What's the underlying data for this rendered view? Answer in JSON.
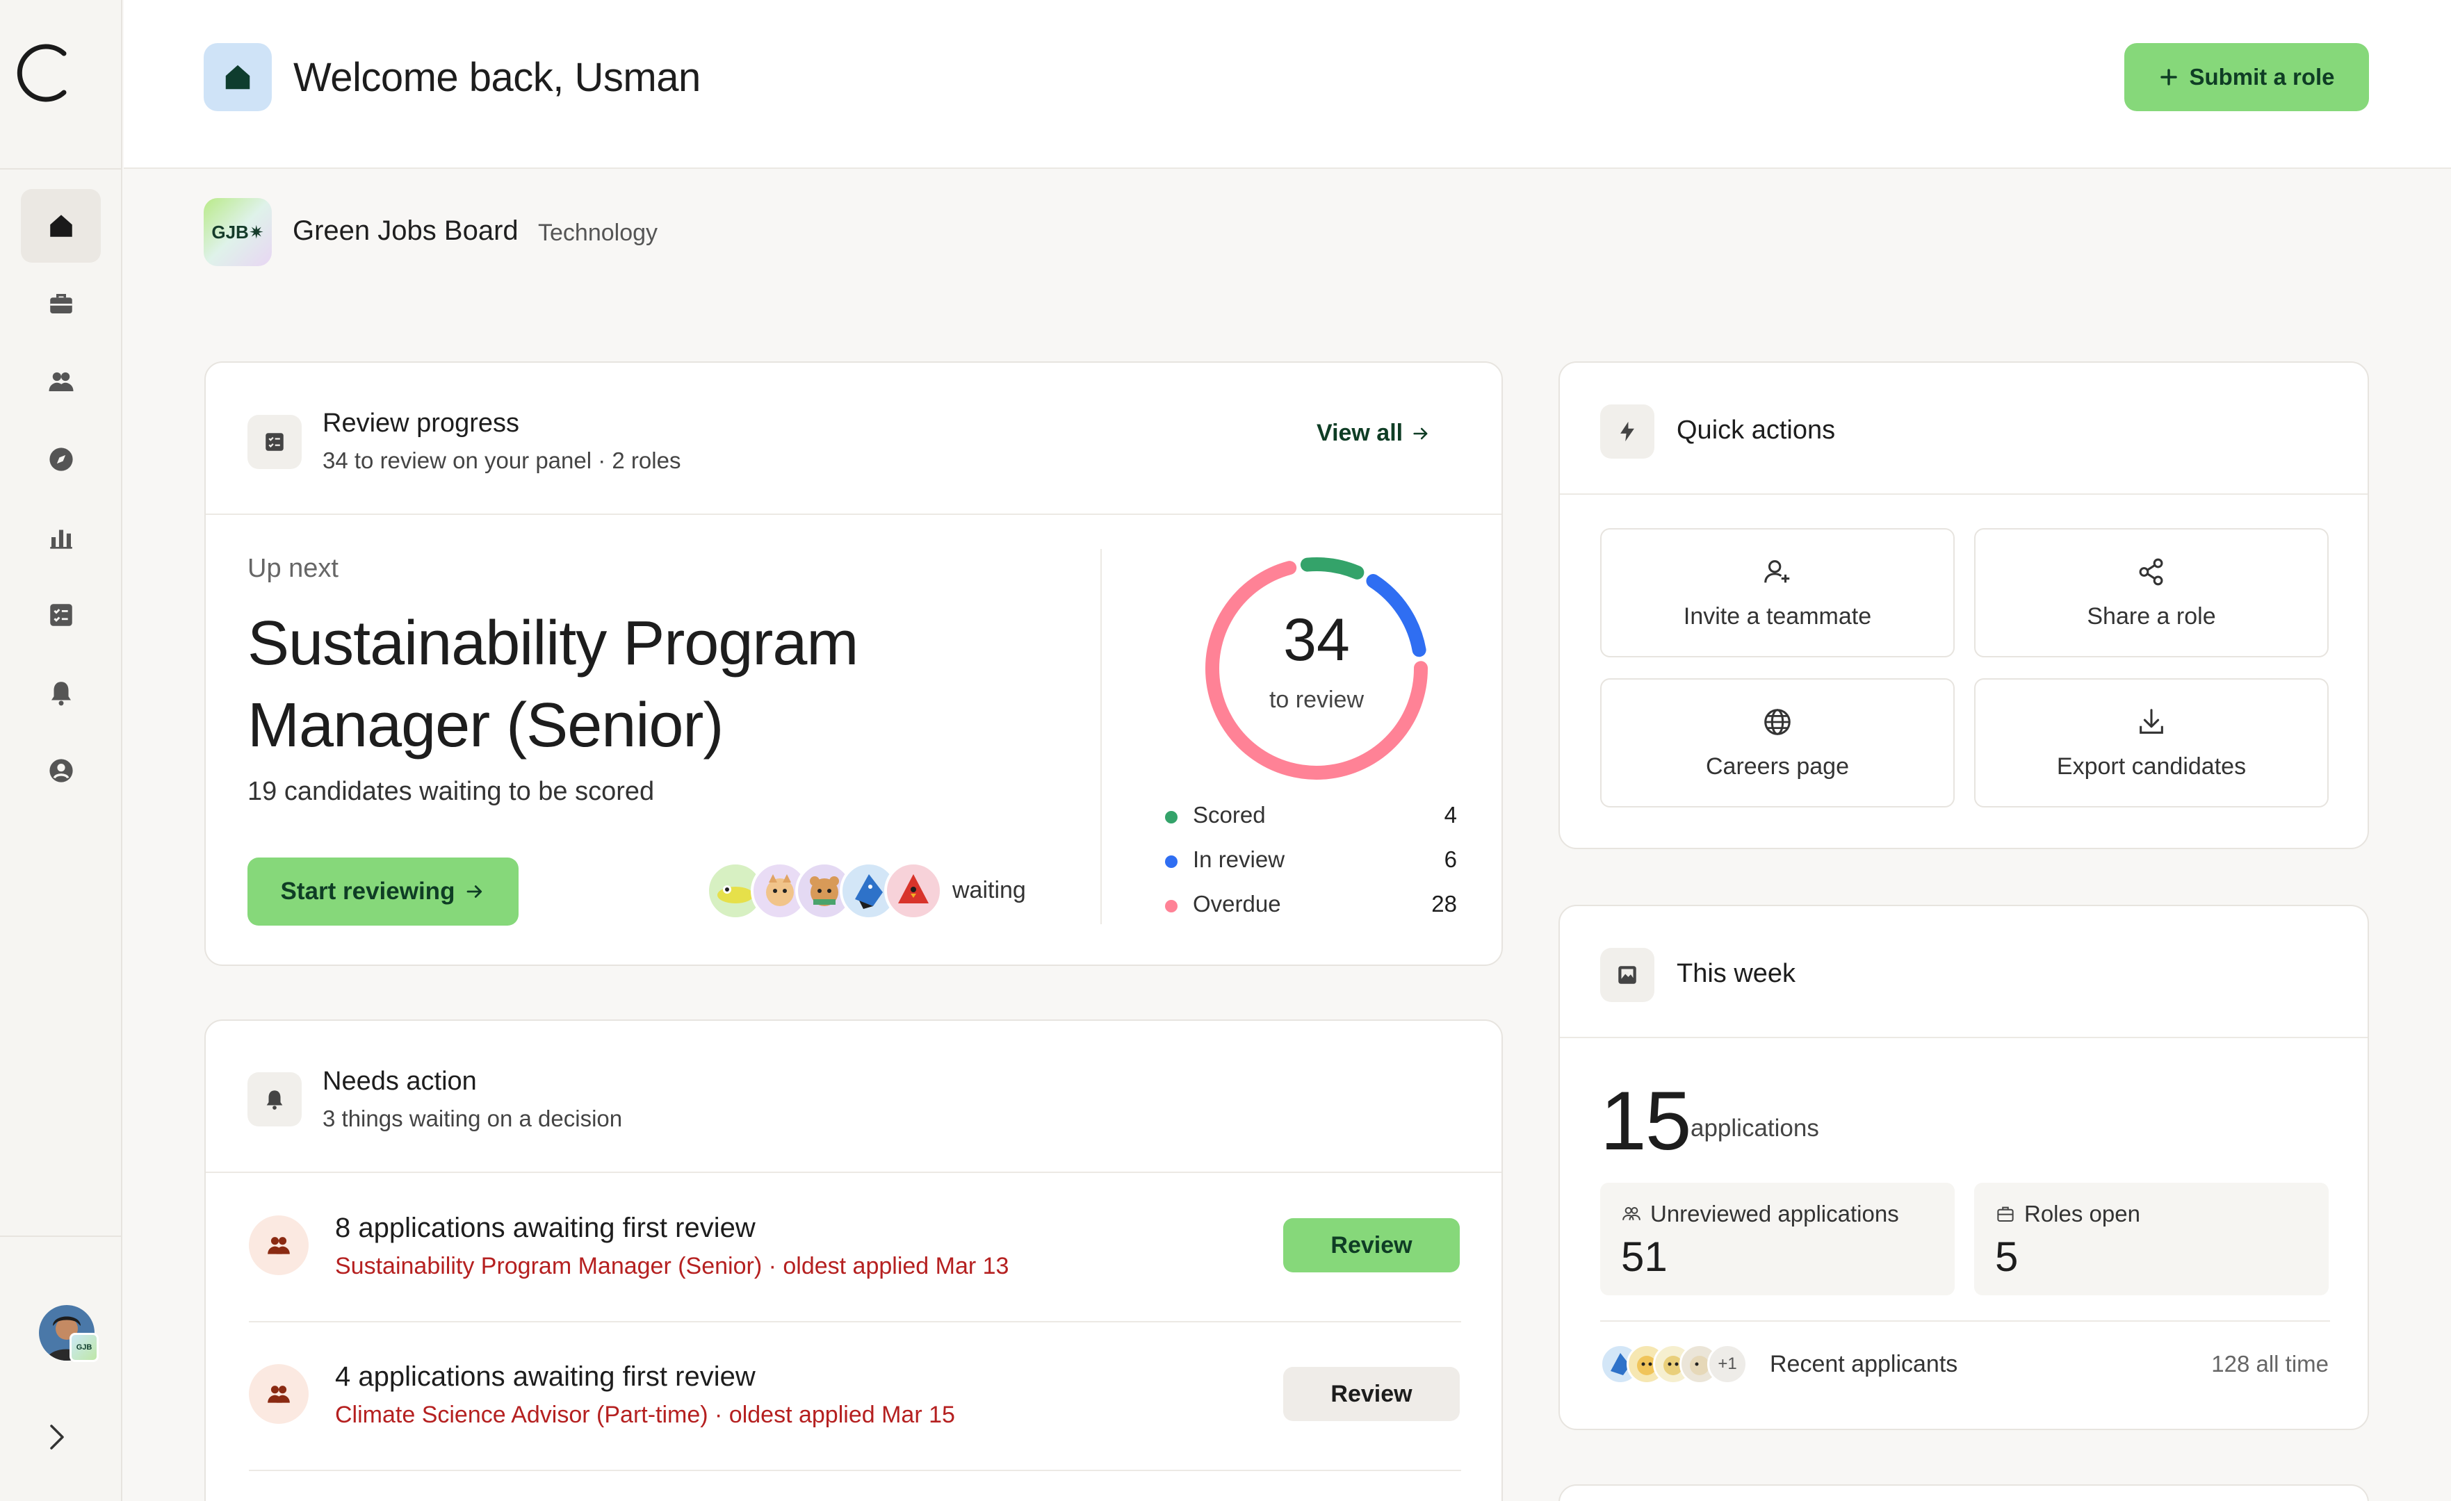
{
  "app": {
    "logo_letter": "C"
  },
  "sidebar": {
    "items": [
      {
        "name": "home",
        "icon": "home-icon",
        "active": true
      },
      {
        "name": "jobs",
        "icon": "briefcase-icon",
        "active": false
      },
      {
        "name": "candidates",
        "icon": "users-icon",
        "active": false
      },
      {
        "name": "discover",
        "icon": "compass-icon",
        "active": false
      },
      {
        "name": "analytics",
        "icon": "bar-chart-icon",
        "active": false
      },
      {
        "name": "tasks",
        "icon": "checklist-icon",
        "active": false
      },
      {
        "name": "notifications",
        "icon": "bell-icon",
        "active": false
      },
      {
        "name": "account",
        "icon": "user-circle-icon",
        "active": false
      }
    ],
    "user_badge": "GJB"
  },
  "header": {
    "welcome": "Welcome back, Usman",
    "submit_label": "Submit a role"
  },
  "org": {
    "logo_text": "GJB✷",
    "name": "Green Jobs Board",
    "category": "Technology"
  },
  "review": {
    "title": "Review progress",
    "subtitle": "34 to review on your panel · 2 roles",
    "view_all": "View all",
    "up_next_label": "Up next",
    "role_title": "Sustainability Program Manager (Senior)",
    "role_subtitle": "19 candidates waiting to be scored",
    "start_label": "Start reviewing",
    "waiting_label": "waiting",
    "donut": {
      "total": "34",
      "label": "to review",
      "segments": [
        {
          "name": "Scored",
          "value": 4,
          "color": "#34a36a"
        },
        {
          "name": "In review",
          "value": 6,
          "color": "#2f6ef2"
        },
        {
          "name": "Overdue",
          "value": 28,
          "color": "#ff8296"
        }
      ]
    },
    "legend": [
      {
        "label": "Scored",
        "value": "4",
        "color": "#34a36a"
      },
      {
        "label": "In review",
        "value": "6",
        "color": "#2f6ef2"
      },
      {
        "label": "Overdue",
        "value": "28",
        "color": "#ff8296"
      }
    ]
  },
  "needs_action": {
    "title": "Needs action",
    "subtitle": "3 things waiting on a decision",
    "rows": [
      {
        "title": "8 applications awaiting first review",
        "sub": "Sustainability Program Manager (Senior) · oldest applied Mar 13",
        "button": "Review"
      },
      {
        "title": "4 applications awaiting first review",
        "sub": "Climate Science Advisor (Part-time) · oldest applied Mar 15",
        "button": "Review"
      }
    ]
  },
  "quick_actions": {
    "title": "Quick actions",
    "items": [
      {
        "label": "Invite a teammate",
        "icon": "user-plus-icon"
      },
      {
        "label": "Share a role",
        "icon": "share-icon"
      },
      {
        "label": "Careers page",
        "icon": "globe-icon"
      },
      {
        "label": "Export candidates",
        "icon": "download-icon"
      }
    ]
  },
  "this_week": {
    "title": "This week",
    "count": "15",
    "count_label": "applications",
    "stats": [
      {
        "label": "Unreviewed applications",
        "value": "51",
        "icon": "users-icon"
      },
      {
        "label": "Roles open",
        "value": "5",
        "icon": "briefcase-icon"
      }
    ],
    "recent_more": "+1",
    "recent_label": "Recent applicants",
    "all_time": "128 all time"
  }
}
